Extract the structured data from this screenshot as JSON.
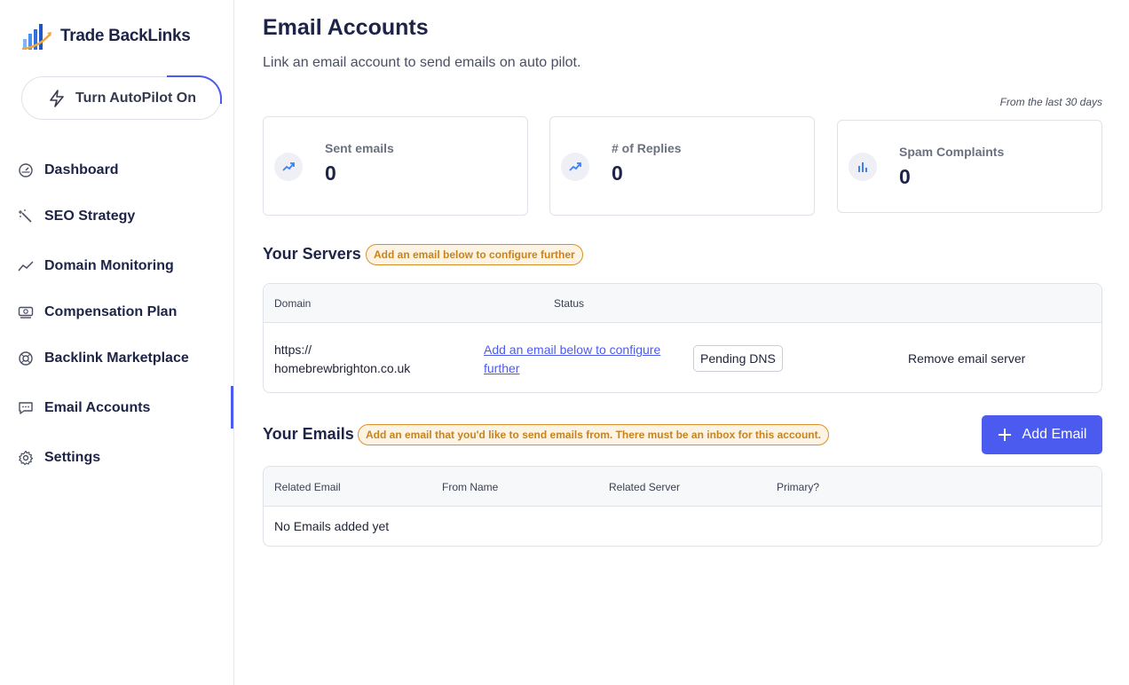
{
  "brand": {
    "name": "Trade BackLinks"
  },
  "sidebar": {
    "autopilot_label": "Turn AutoPilot On",
    "items": [
      {
        "label": "Dashboard",
        "icon": "dashboard-gauge-icon"
      },
      {
        "label": "SEO Strategy",
        "icon": "magic-wand-icon"
      },
      {
        "label": "Domain Monitoring",
        "icon": "trend-line-icon"
      },
      {
        "label": "Compensation Plan",
        "icon": "money-icon"
      },
      {
        "label": "Backlink Marketplace",
        "icon": "lifebuoy-icon"
      },
      {
        "label": "Email Accounts",
        "icon": "chat-bubble-icon",
        "active": true
      },
      {
        "label": "Settings",
        "icon": "gear-icon"
      }
    ]
  },
  "page": {
    "title": "Email Accounts",
    "subtitle": "Link an email account to send emails on auto pilot.",
    "period_note": "From the last 30 days"
  },
  "stats": [
    {
      "label": "Sent emails",
      "value": "0",
      "icon": "trending-up-icon"
    },
    {
      "label": "# of Replies",
      "value": "0",
      "icon": "trending-up-icon"
    },
    {
      "label": "Spam Complaints",
      "value": "0",
      "icon": "bar-chart-icon"
    }
  ],
  "servers": {
    "title": "Your Servers",
    "hint": "Add an email below to configure further",
    "columns": [
      "Domain",
      "Status"
    ],
    "rows": [
      {
        "domain_line1": "https://",
        "domain_line2": "homebrewbrighton.co.uk",
        "configure_link": "Add an email below to configure further",
        "status": "Pending DNS",
        "remove_label": "Remove email server"
      }
    ]
  },
  "emails": {
    "title": "Your Emails",
    "hint": "Add an email that you'd like to send emails from. There must be an inbox for this account.",
    "add_button": "Add Email",
    "columns": [
      "Related Email",
      "From Name",
      "Related Server",
      "Primary?"
    ],
    "empty_message": "No Emails added yet"
  },
  "colors": {
    "accent": "#4b5bf0",
    "warning": "#d9902b",
    "text": "#1e2447"
  }
}
